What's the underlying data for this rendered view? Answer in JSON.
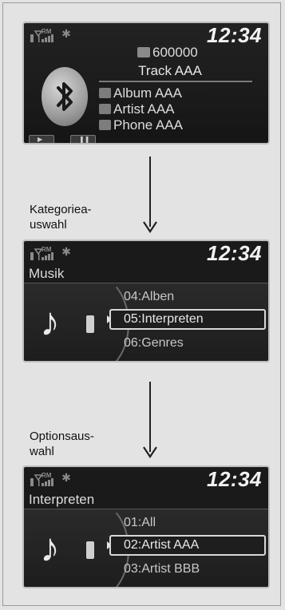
{
  "screens": [
    {
      "clock": "12:34",
      "status_rm": "RM",
      "phone": {
        "track_number": "600000",
        "track_title": "Track AAA",
        "album": "Album AAA",
        "artist": "Artist AAA",
        "phone": "Phone AAA",
        "play_icon": "play-icon",
        "pause_icon": "pause-icon"
      }
    },
    {
      "clock": "12:34",
      "status_rm": "RM",
      "title": "Musik",
      "items": [
        "04:Alben",
        "05:Interpreten",
        "06:Genres"
      ],
      "selected_index": 1
    },
    {
      "clock": "12:34",
      "status_rm": "RM",
      "title": "Interpreten",
      "items": [
        "01:All",
        "02:Artist AAA",
        "03:Artist BBB"
      ],
      "selected_index": 1
    }
  ],
  "steps": [
    {
      "caption_line1": "Kategoriea-",
      "caption_line2": "uswahl"
    },
    {
      "caption_line1": "Optionsaus-",
      "caption_line2": "wahl"
    }
  ],
  "colors": {
    "screen_bg": "#1a1a1a",
    "page_bg": "#e3e3e3",
    "highlight_border": "#d8d8d8"
  }
}
